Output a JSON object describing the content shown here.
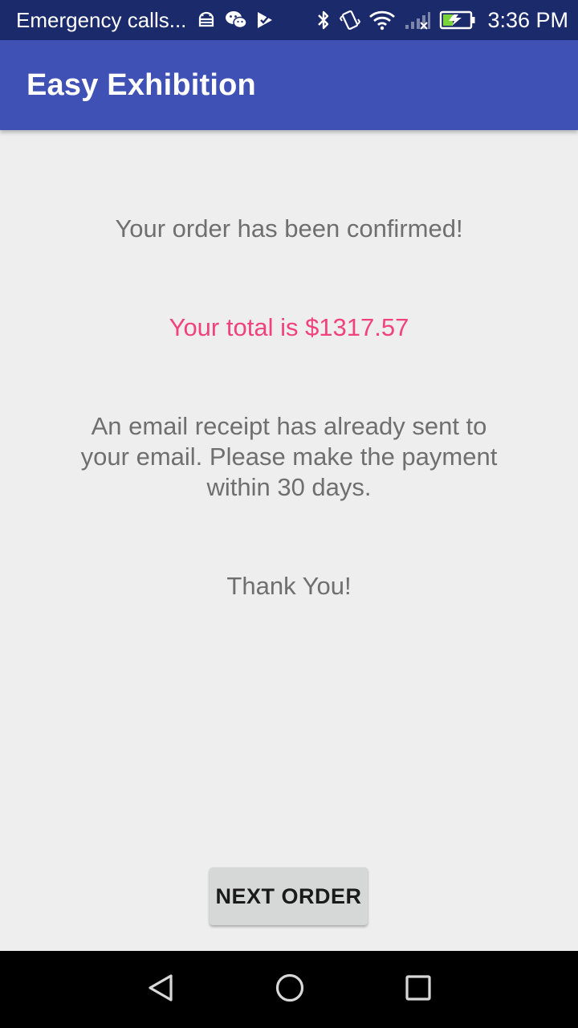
{
  "status_bar": {
    "notification_text": "Emergency calls...",
    "time": "3:36 PM",
    "left_icons": [
      "android-debug-icon",
      "wechat-icon",
      "play-store-icon"
    ],
    "right_icons": [
      "bluetooth-icon",
      "vibrate-icon",
      "wifi-icon",
      "signal-icon",
      "battery-charging-icon"
    ],
    "background_color": "#1b2a6b"
  },
  "app_bar": {
    "title": "Easy Exhibition",
    "background_color": "#3f51b5"
  },
  "content": {
    "confirmed_text": "Your order has been confirmed!",
    "total_text": "Your total is $1317.57",
    "email_text": "An email receipt has already sent to your email. Please make the payment within 30 days.",
    "thanks_text": "Thank You!",
    "total_color": "#f0427c",
    "text_color": "#6f6f6f"
  },
  "actions": {
    "next_order_label": "NEXT ORDER"
  },
  "nav_bar": {
    "icons": [
      "back-icon",
      "home-icon",
      "recents-icon"
    ]
  }
}
